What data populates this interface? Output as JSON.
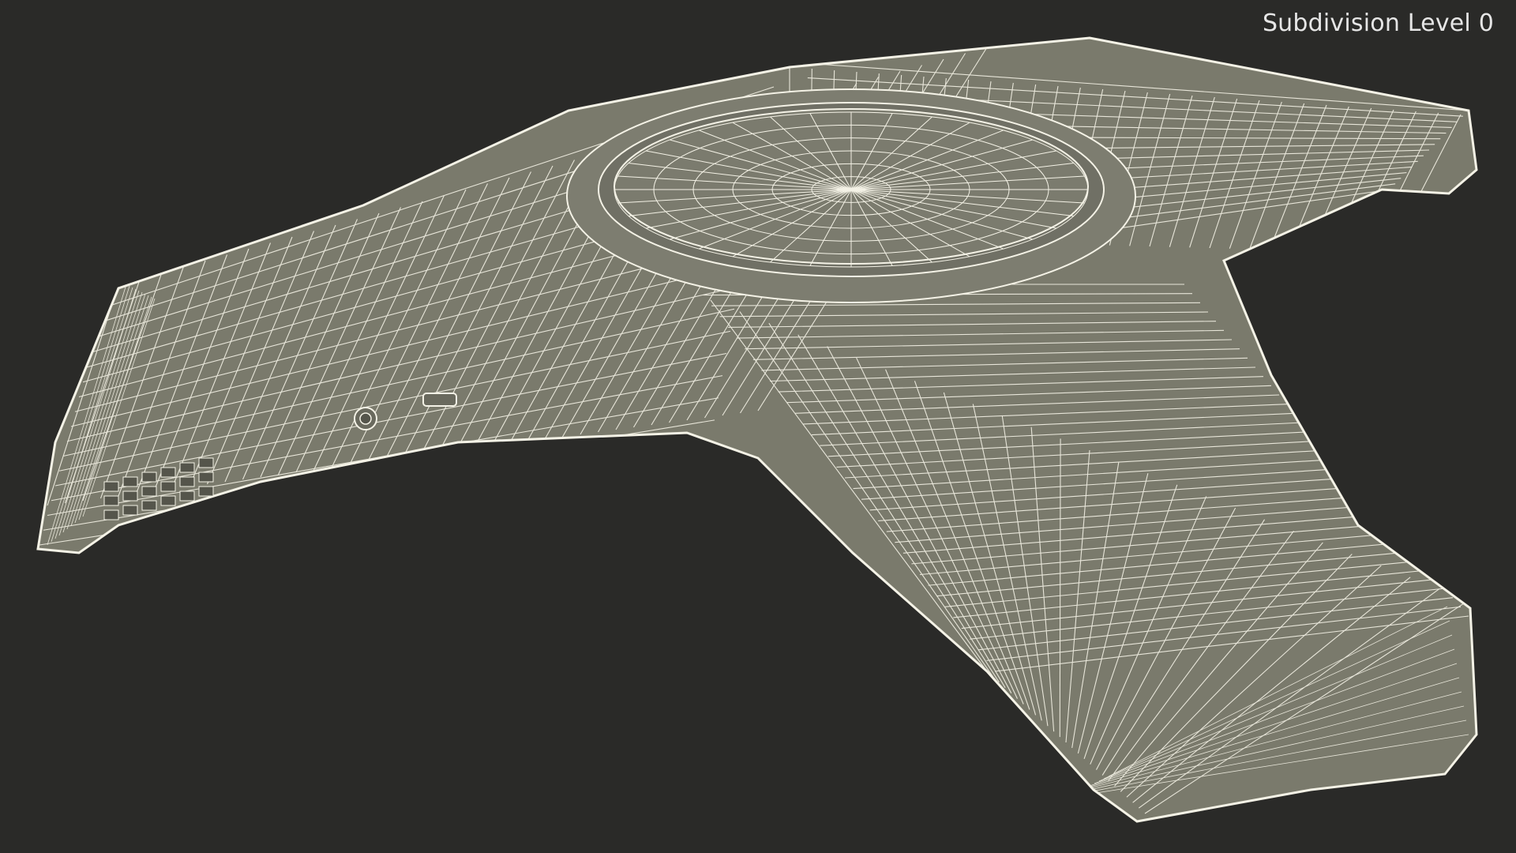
{
  "viewport": {
    "overlay_label": "Subdivision Level 0"
  },
  "model": {
    "subject": "conference-phone-wireframe",
    "surface_color": "#7a7a6c",
    "wire_color": "#f4f2e6",
    "background_color": "#2a2a28"
  }
}
